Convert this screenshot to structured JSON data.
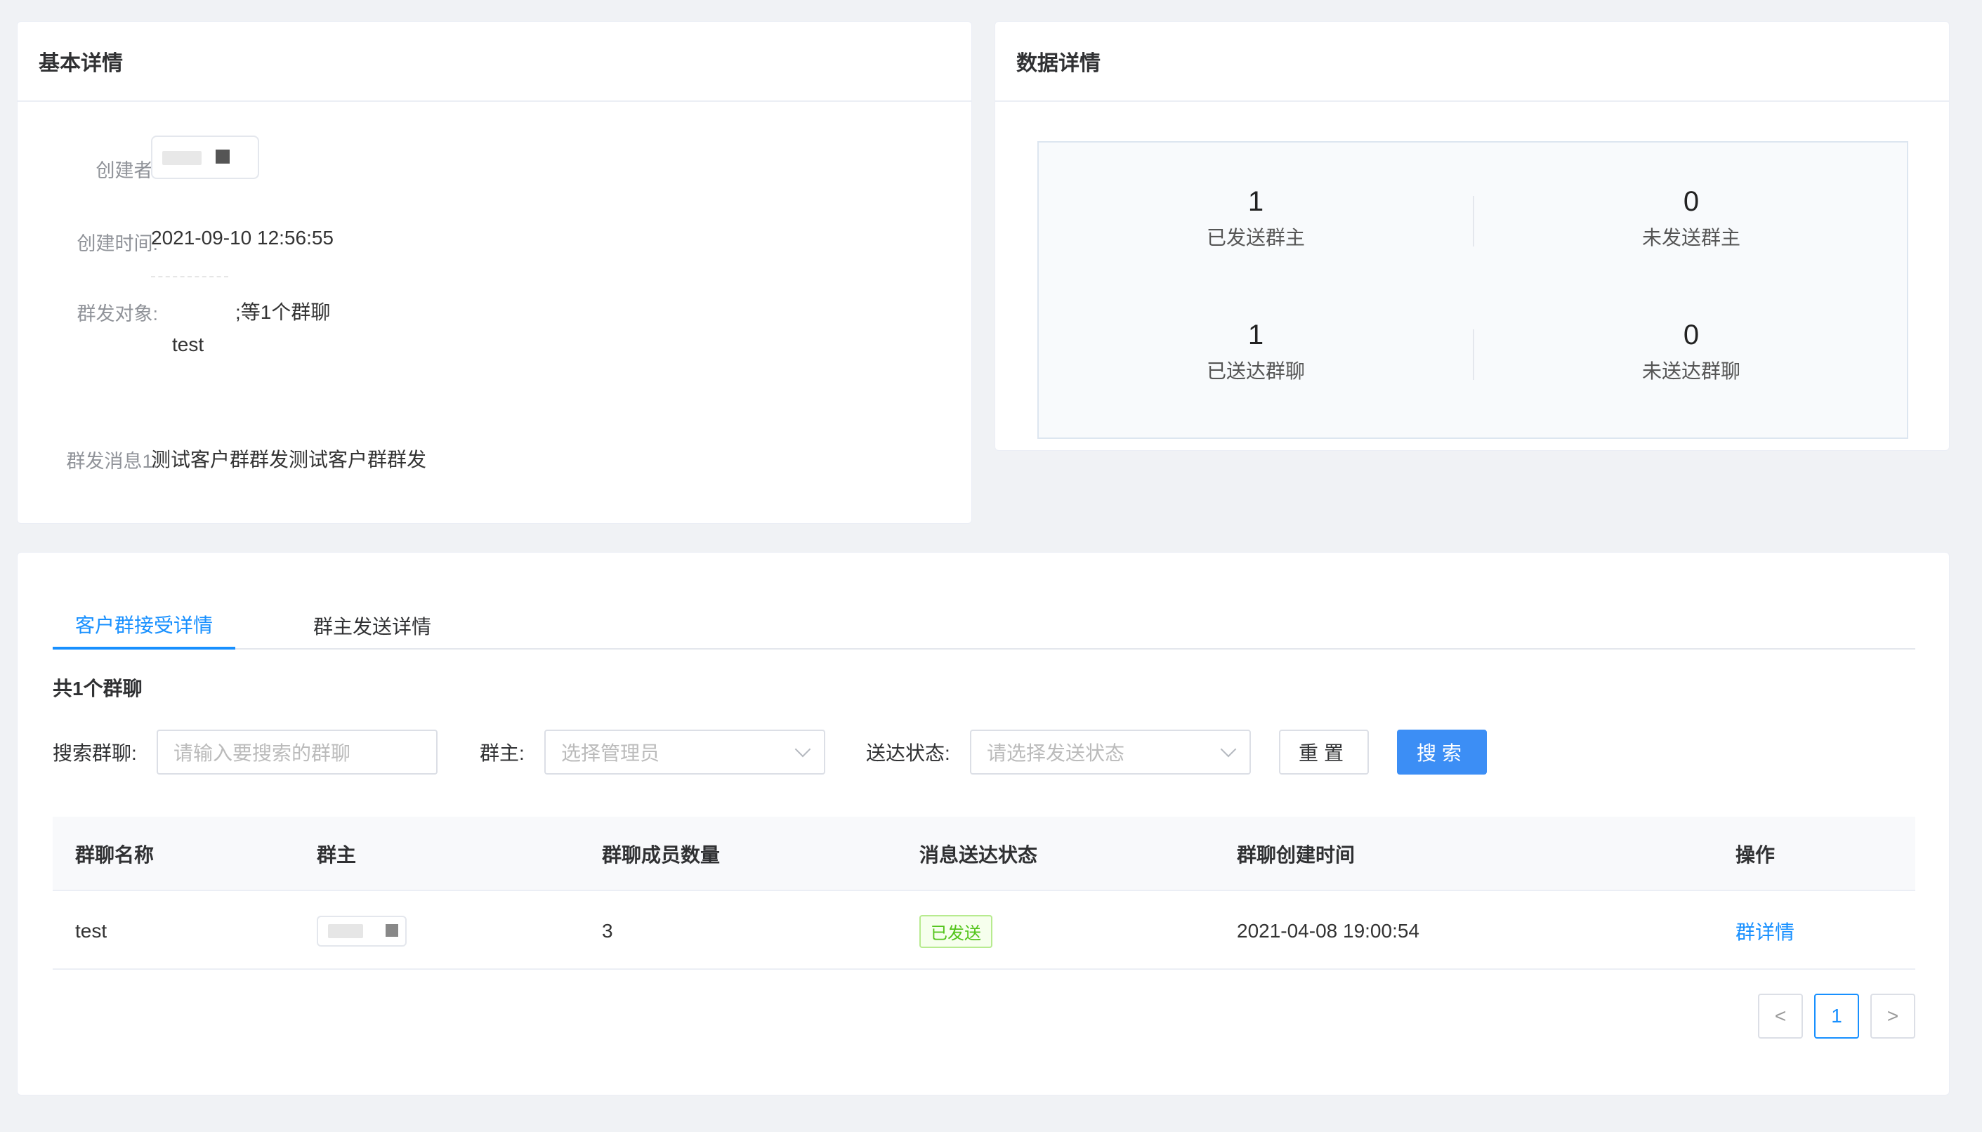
{
  "basic": {
    "title": "基本详情",
    "creator_label": "创建者:",
    "created_time_label": "创建时间:",
    "created_time": "2021-09-10 12:56:55",
    "target_label": "群发对象:",
    "target_suffix": ";等1个群聊",
    "target_name": "test",
    "message_label": "群发消息1:",
    "message": "测试客户群群发测试客户群群发"
  },
  "data_detail": {
    "title": "数据详情",
    "stats": [
      {
        "value": "1",
        "label": "已发送群主"
      },
      {
        "value": "0",
        "label": "未发送群主"
      },
      {
        "value": "1",
        "label": "已送达群聊"
      },
      {
        "value": "0",
        "label": "未送达群聊"
      }
    ]
  },
  "tabs": [
    {
      "label": "客户群接受详情",
      "active": true
    },
    {
      "label": "群主发送详情",
      "active": false
    }
  ],
  "summary": "共1个群聊",
  "filters": {
    "search_label": "搜索群聊:",
    "search_placeholder": "请输入要搜索的群聊",
    "owner_label": "群主:",
    "owner_placeholder": "选择管理员",
    "status_label": "送达状态:",
    "status_placeholder": "请选择发送状态",
    "reset_label": "重置",
    "search_button": "搜索"
  },
  "table": {
    "columns": [
      "群聊名称",
      "群主",
      "群聊成员数量",
      "消息送达状态",
      "群聊创建时间",
      "操作"
    ],
    "rows": [
      {
        "name": "test",
        "members": "3",
        "status": "已发送",
        "created": "2021-04-08 19:00:54",
        "action": "群详情"
      }
    ]
  },
  "pagination": {
    "prev": "<",
    "current": "1",
    "next": ">"
  },
  "colors": {
    "primary": "#1890ff",
    "success": "#52c41a",
    "background": "#f0f2f5"
  }
}
